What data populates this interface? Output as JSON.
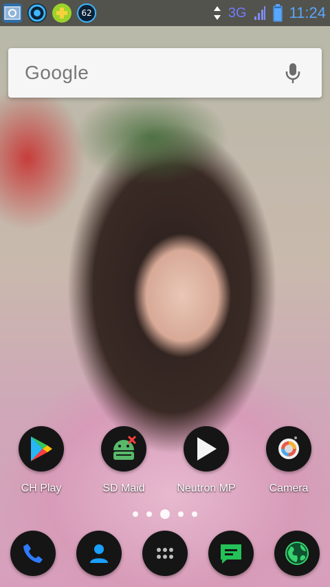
{
  "status_bar": {
    "notification_badge": "62",
    "network": "3G",
    "time": "11:24"
  },
  "search": {
    "logo_text": "Google"
  },
  "home_apps": [
    {
      "label": "CH Play",
      "icon": "play-store-icon"
    },
    {
      "label": "SD Maid",
      "icon": "android-robot-icon"
    },
    {
      "label": "Neutron MP",
      "icon": "play-icon"
    },
    {
      "label": "Camera",
      "icon": "camera-lens-icon"
    }
  ],
  "page_indicator": {
    "pages": 5,
    "current": 3
  },
  "dock": [
    {
      "icon": "phone-icon"
    },
    {
      "icon": "contacts-icon"
    },
    {
      "icon": "app-drawer-icon"
    },
    {
      "icon": "messages-icon"
    },
    {
      "icon": "browser-globe-icon"
    }
  ],
  "colors": {
    "status_clock": "#5aa7ff",
    "network_label": "#6f7cff",
    "phone_blue": "#2f7bff",
    "contacts_blue": "#19a0ff",
    "messages_green": "#23c157",
    "globe_green": "#36d36f"
  }
}
